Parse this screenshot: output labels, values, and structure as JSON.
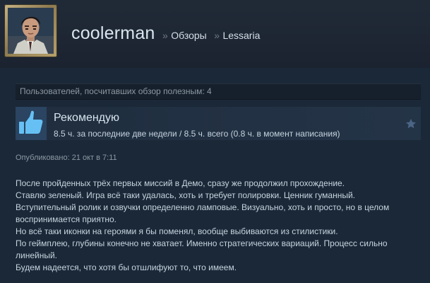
{
  "header": {
    "username": "coolerman",
    "crumb_sep": "»",
    "breadcrumbs": [
      "Обзоры",
      "Lessaria"
    ]
  },
  "helpful": {
    "text": "Пользователей, посчитавших обзор полезным: 4"
  },
  "recommendation": {
    "title": "Рекомендую",
    "hours": "8.5 ч. за последние две недели / 8.5 ч. всего (0.8 ч. в момент написания)",
    "icon": "thumbs-up-icon",
    "accent": "#66c0f4"
  },
  "posted": "Опубликовано: 21 окт в 7:11",
  "review": {
    "lines": [
      "После пройденных трёх первых миссий в Демо, сразу же продолжил прохождение.",
      "Ставлю зеленый. Игра всё таки удалась, хоть и требует полировки. Ценник гуманный.",
      "Вступительный ролик и озвучки определенно ламповые. Визуально, хоть и просто, но в целом воспринимается приятно.",
      "Но всё таки иконки на героями я бы поменял, вообще выбиваются из стилистики.",
      "По геймплею, глубины конечно не хватает. Именно стратегических вариаций. Процесс сильно линейный.",
      "Будем надеется, что хотя бы отшлифуют то, что имеем."
    ]
  },
  "colors": {
    "background": "#1b2838",
    "text": "#c6d4df",
    "muted": "#8c98a3",
    "star": "#4b6585"
  }
}
